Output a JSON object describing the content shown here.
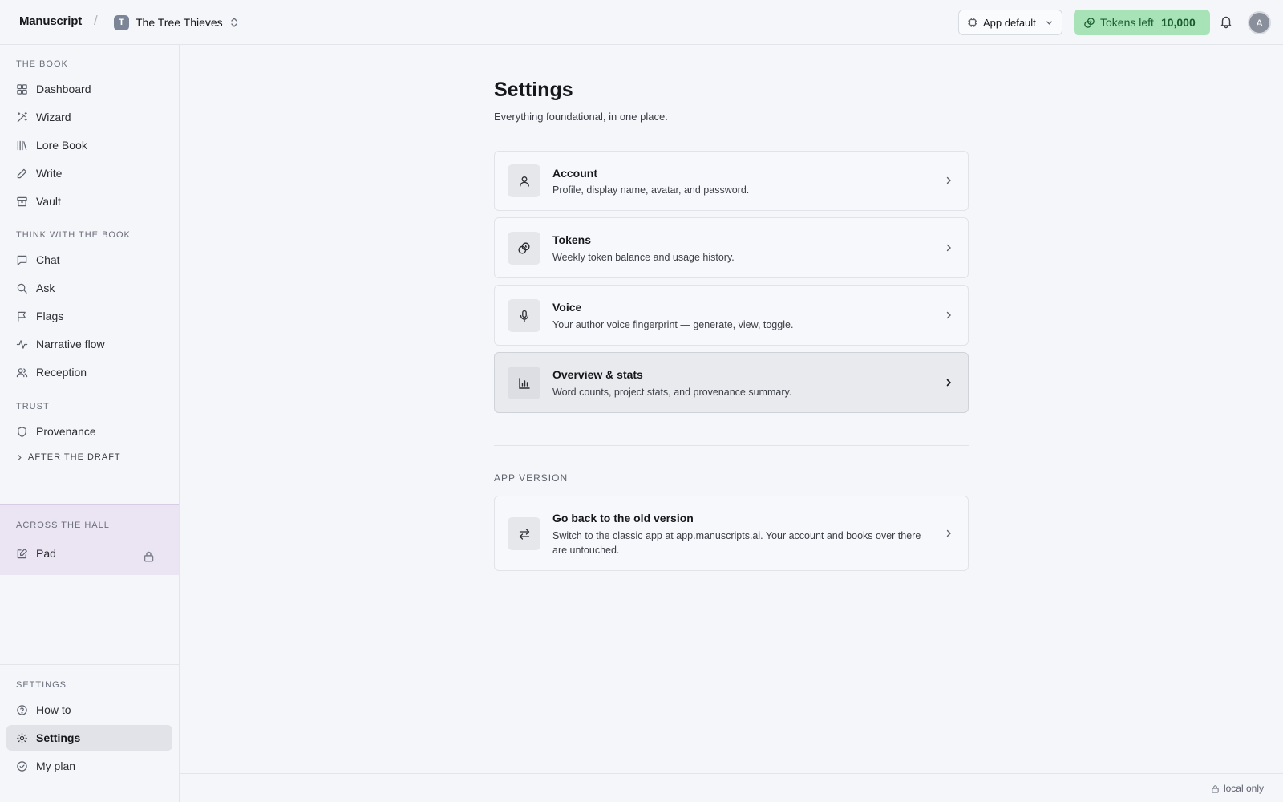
{
  "header": {
    "brand": "Manuscript",
    "separator": "/",
    "project": {
      "initial": "T",
      "name": "The Tree Thieves"
    },
    "theme_button": "App default",
    "tokens": {
      "label": "Tokens left",
      "value": "10,000",
      "color": "#a8e3b8"
    },
    "user_initial": "A"
  },
  "sidebar": {
    "sections": [
      {
        "title": "THE BOOK",
        "items": [
          {
            "label": "Dashboard",
            "icon": "grid-icon"
          },
          {
            "label": "Wizard",
            "icon": "magic-wand-icon"
          },
          {
            "label": "Lore Book",
            "icon": "library-icon"
          },
          {
            "label": "Write",
            "icon": "pencil-icon"
          },
          {
            "label": "Vault",
            "icon": "archive-icon"
          }
        ]
      },
      {
        "title": "THINK WITH THE BOOK",
        "items": [
          {
            "label": "Chat",
            "icon": "chat-icon"
          },
          {
            "label": "Ask",
            "icon": "search-icon"
          },
          {
            "label": "Flags",
            "icon": "flag-icon"
          },
          {
            "label": "Narrative flow",
            "icon": "activity-icon"
          },
          {
            "label": "Reception",
            "icon": "users-icon"
          }
        ]
      },
      {
        "title": "TRUST",
        "items": [
          {
            "label": "Provenance",
            "icon": "shield-icon"
          }
        ]
      }
    ],
    "collapsed_section": "AFTER THE DRAFT",
    "hall": {
      "title": "ACROSS THE HALL",
      "item": "Pad",
      "color": "#ebe4f3"
    },
    "settings_section": {
      "title": "SETTINGS",
      "items": [
        {
          "label": "How to",
          "icon": "help-circle-icon"
        },
        {
          "label": "Settings",
          "icon": "gear-icon",
          "active": true
        },
        {
          "label": "My plan",
          "icon": "check-circle-icon"
        }
      ]
    }
  },
  "main": {
    "title": "Settings",
    "subtitle": "Everything foundational, in one place.",
    "cards": [
      {
        "title": "Account",
        "desc": "Profile, display name, avatar, and password.",
        "icon": "user-icon"
      },
      {
        "title": "Tokens",
        "desc": "Weekly token balance and usage history.",
        "icon": "coins-icon"
      },
      {
        "title": "Voice",
        "desc": "Your author voice fingerprint — generate, view, toggle.",
        "icon": "microphone-icon"
      },
      {
        "title": "Overview & stats",
        "desc": "Word counts, project stats, and provenance summary.",
        "icon": "bar-chart-icon"
      }
    ],
    "app_version": {
      "label": "APP VERSION",
      "card": {
        "title": "Go back to the old version",
        "desc": "Switch to the classic app at app.manuscripts.ai. Your account and books over there are untouched.",
        "icon": "swap-icon"
      }
    }
  },
  "footer": {
    "status": "local only"
  }
}
